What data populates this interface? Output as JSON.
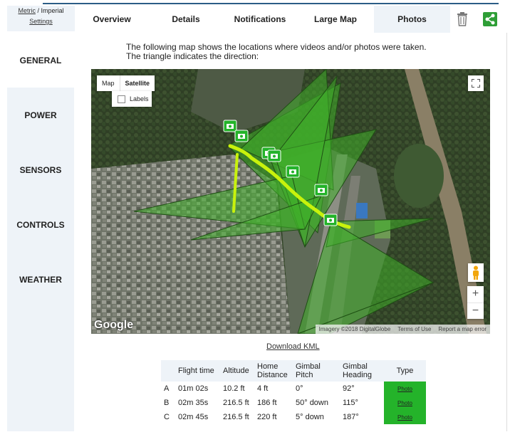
{
  "units": {
    "metric": "Metric",
    "sep": "/",
    "imperial": "Imperial",
    "settings": "Settings"
  },
  "tabs": [
    "Overview",
    "Details",
    "Notifications",
    "Large Map",
    "Photos"
  ],
  "header_icons": [
    "trash-icon",
    "share-icon"
  ],
  "sidebar": [
    "GENERAL",
    "POWER",
    "SENSORS",
    "CONTROLS",
    "WEATHER"
  ],
  "intro": {
    "line1": "The following map shows the locations where videos and/or photos were taken.",
    "line2": "The triangle indicates the direction:"
  },
  "map": {
    "map_btn": "Map",
    "satellite_btn": "Satellite",
    "labels": "Labels",
    "zoom_in": "+",
    "zoom_out": "−",
    "logo": "Google",
    "imagery": "Imagery ©2018 DigitalGlobe",
    "terms": "Terms of Use",
    "report": "Report a map error"
  },
  "download_kml": "Download KML",
  "table": {
    "headers": [
      "",
      "Flight time",
      "Altitude",
      "Home Distance",
      "Gimbal Pitch",
      "Gimbal Heading",
      "Type"
    ],
    "rows": [
      {
        "id": "A",
        "time": "01m 02s",
        "alt": "10.2 ft",
        "dist": "4 ft",
        "pitch": "0°",
        "heading": "92°",
        "type": "Photo"
      },
      {
        "id": "B",
        "time": "02m 35s",
        "alt": "216.5 ft",
        "dist": "186 ft",
        "pitch": "50° down",
        "heading": "115°",
        "type": "Photo"
      },
      {
        "id": "C",
        "time": "02m 45s",
        "alt": "216.5 ft",
        "dist": "220 ft",
        "pitch": "5° down",
        "heading": "187°",
        "type": "Photo"
      }
    ]
  },
  "colors": {
    "accent": "#2b5d86",
    "tab_bg": "#eef3f8",
    "photo_green": "#24b32a",
    "triangle_fill": "#3fae2a",
    "path_yellow": "#c8f20c"
  }
}
